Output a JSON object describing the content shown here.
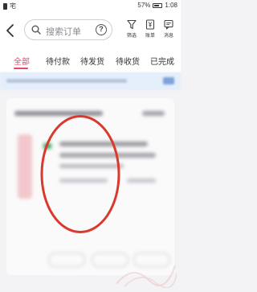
{
  "status_bar": {
    "carrier": "宅",
    "battery": "57%",
    "time": "1:08"
  },
  "header": {
    "search_placeholder": "搜索订单",
    "tools": [
      {
        "label": "筛选",
        "icon": "filter-icon"
      },
      {
        "label": "账单",
        "icon": "bill-icon"
      },
      {
        "label": "消息",
        "icon": "message-icon"
      }
    ]
  },
  "tabs": [
    {
      "label": "全部",
      "active": true
    },
    {
      "label": "待付款",
      "active": false
    },
    {
      "label": "待发货",
      "active": false
    },
    {
      "label": "待收货",
      "active": false
    },
    {
      "label": "已完成",
      "active": false
    }
  ],
  "colors": {
    "accent": "#e8466d",
    "annotation": "#d93a2e"
  }
}
